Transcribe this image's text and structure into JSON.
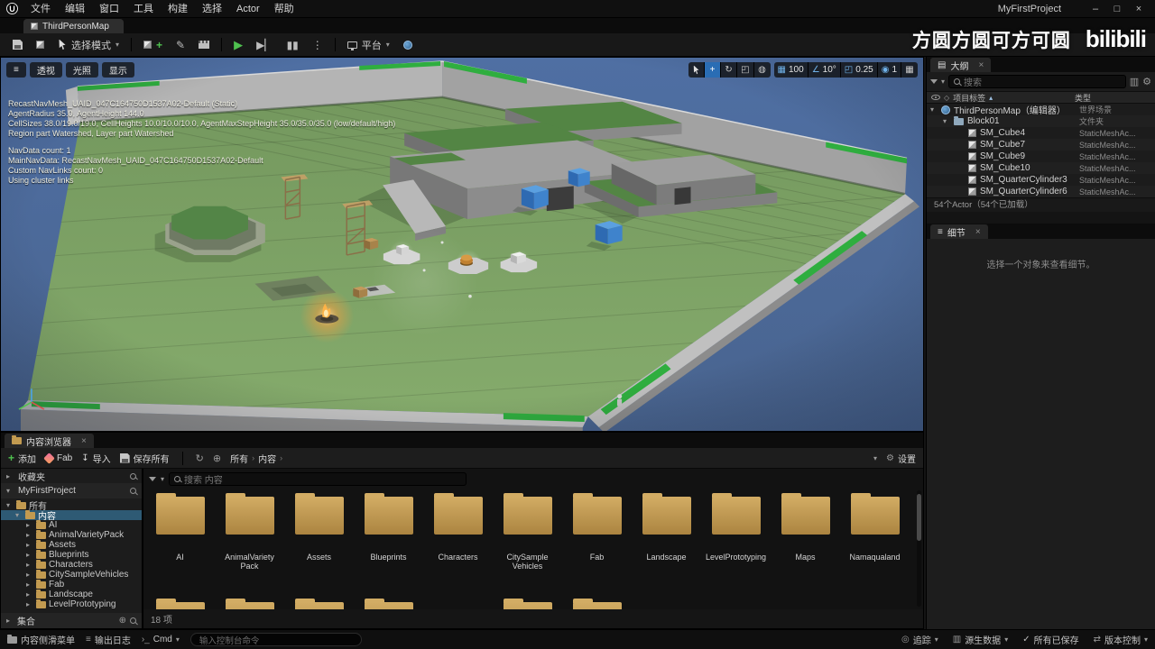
{
  "titlebar": {
    "menus": [
      "文件",
      "编辑",
      "窗口",
      "工具",
      "构建",
      "选择",
      "Actor",
      "帮助"
    ],
    "project": "MyFirstProject"
  },
  "tabbar": {
    "level_tab": "ThirdPersonMap"
  },
  "toolbar": {
    "mode_label": "选择模式",
    "platform_label": "平台"
  },
  "watermark": {
    "text": "方圆方圆可方可圆",
    "logo": "bilibili"
  },
  "viewport": {
    "view_buttons": [
      "透视",
      "光照",
      "显示"
    ],
    "debug_block1": [
      "RecastNavMesh_UAID_047C164750D1537A02-Default (Static)",
      "AgentRadius 35.0, AgentHeight 144.0",
      "CellSizes 38.0/19.0/19.0, CellHeights 10.0/10.0/10.0, AgentMaxStepHeight 35.0/35.0/35.0 (low/default/high)",
      "Region part Watershed, Layer part Watershed"
    ],
    "debug_block2": [
      "NavData count: 1",
      "MainNavData: RecastNavMesh_UAID_047C164750D1537A02-Default",
      "Custom NavLinks count: 0",
      "Using cluster links"
    ],
    "snap": {
      "grid": "100",
      "angle": "10°",
      "scale": "0.25",
      "camera": "1"
    }
  },
  "outliner": {
    "tab": "大纲",
    "search_placeholder": "搜索",
    "col_label": "项目标签",
    "col_type": "类型",
    "rows": [
      {
        "label": "ThirdPersonMap（编辑器）",
        "type": "世界场景"
      },
      {
        "label": "Block01",
        "type": "文件夹"
      },
      {
        "label": "SM_Cube4",
        "type": "StaticMeshAc..."
      },
      {
        "label": "SM_Cube7",
        "type": "StaticMeshAc..."
      },
      {
        "label": "SM_Cube9",
        "type": "StaticMeshAc..."
      },
      {
        "label": "SM_Cube10",
        "type": "StaticMeshAc..."
      },
      {
        "label": "SM_QuarterCylinder3",
        "type": "StaticMeshAc..."
      },
      {
        "label": "SM_QuarterCylinder6",
        "type": "StaticMeshAc..."
      }
    ],
    "footer": "54个Actor（54个已加载）"
  },
  "details": {
    "tab": "细节",
    "empty_text": "选择一个对象来查看细节。"
  },
  "content": {
    "tab": "内容浏览器",
    "btn_add": "添加",
    "btn_fab": "Fab",
    "btn_import": "导入",
    "btn_save_all": "保存所有",
    "breadcrumb": [
      "所有",
      "内容"
    ],
    "btn_settings": "设置",
    "favorites": "收藏夹",
    "project": "MyFirstProject",
    "tree_all": "所有",
    "tree_content": "内容",
    "tree": [
      "AI",
      "AnimalVarietyPack",
      "Assets",
      "Blueprints",
      "Characters",
      "CitySampleVehicles",
      "Fab",
      "Landscape",
      "LevelPrototyping"
    ],
    "collections": "集合",
    "search_placeholder": "搜索 内容",
    "folders": [
      "AI",
      "AnimalVariety Pack",
      "Assets",
      "Blueprints",
      "Characters",
      "CitySample Vehicles",
      "Fab",
      "Landscape",
      "LevelPrototyping",
      "Maps",
      "Namaqualand"
    ],
    "count": "18 项"
  },
  "statusbar": {
    "drawer": "内容侧滑菜单",
    "output_log": "输出日志",
    "cmd": "Cmd",
    "console_placeholder": "输入控制台命令",
    "trace": "追踪",
    "derived_data": "源生数据",
    "all_saved": "所有已保存",
    "revision": "版本控制"
  }
}
